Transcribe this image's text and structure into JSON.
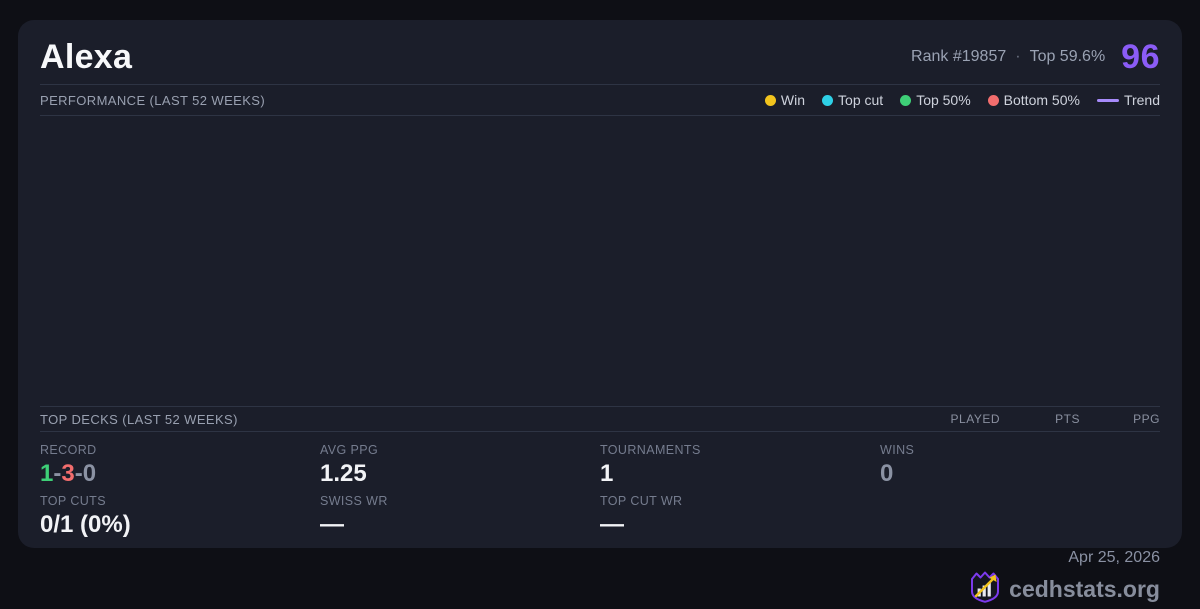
{
  "header": {
    "title": "Alexa",
    "rank": "Rank #19857",
    "separator": "·",
    "top_percent": "Top 59.6%",
    "score": "96"
  },
  "performance": {
    "title": "PERFORMANCE (LAST 52 WEEKS)",
    "legend": [
      {
        "label": "Win",
        "color": "#f2c41d"
      },
      {
        "label": "Top cut",
        "color": "#2ed0e6"
      },
      {
        "label": "Top 50%",
        "color": "#3ecf77"
      },
      {
        "label": "Bottom 50%",
        "color": "#f26d6d"
      },
      {
        "label": "Trend",
        "color": "#a78bfa",
        "type": "line"
      }
    ]
  },
  "top_decks": {
    "title": "TOP DECKS (LAST 52 WEEKS)",
    "columns": {
      "played": "PLAYED",
      "pts": "PTS",
      "ppg": "PPG"
    }
  },
  "stats": {
    "record": {
      "label": "RECORD",
      "wins": "1",
      "losses": "3",
      "draws": "0",
      "separator": "-",
      "win_color": "#3ecf77",
      "loss_color": "#f26d6d",
      "draw_color": "#8b92a3"
    },
    "avg_ppg": {
      "label": "AVG PPG",
      "value": "1.25"
    },
    "tournaments": {
      "label": "TOURNAMENTS",
      "value": "1"
    },
    "wins": {
      "label": "WINS",
      "value": "0",
      "color": "#8b92a3"
    },
    "top_cuts": {
      "label": "TOP CUTS",
      "value": "0/1 (0%)"
    },
    "swiss_wr": {
      "label": "SWISS WR",
      "value": "—"
    },
    "top_cut_wr": {
      "label": "TOP CUT WR",
      "value": "—"
    }
  },
  "footer": {
    "date": "Apr 25, 2026",
    "site": "cedhstats.org"
  },
  "colors": {
    "accent": "#8b5cf6",
    "trend": "#a78bfa",
    "card_bg": "#1b1e2a",
    "page_bg": "#0e0f15",
    "logo_outline": "#7c3aed",
    "logo_arrow": "#f2c41d"
  }
}
